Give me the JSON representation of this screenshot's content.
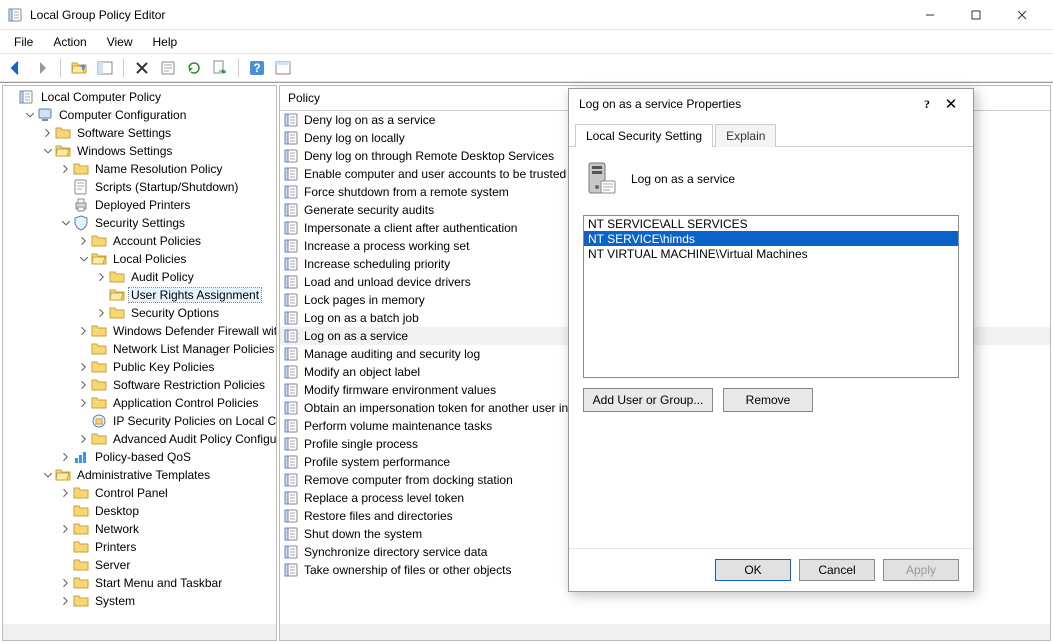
{
  "window": {
    "title": "Local Group Policy Editor"
  },
  "menu": {
    "file": "File",
    "action": "Action",
    "view": "View",
    "help": "Help"
  },
  "tree": {
    "root": "Local Computer Policy",
    "cc": "Computer Configuration",
    "sw": "Software Settings",
    "ws": "Windows Settings",
    "nrp": "Name Resolution Policy",
    "scripts": "Scripts (Startup/Shutdown)",
    "dp": "Deployed Printers",
    "ss": "Security Settings",
    "ap": "Account Policies",
    "lp": "Local Policies",
    "audit": "Audit Policy",
    "ura": "User Rights Assignment",
    "so": "Security Options",
    "wdf": "Windows Defender Firewall with Advanced Security",
    "nlm": "Network List Manager Policies",
    "pkp": "Public Key Policies",
    "srp": "Software Restriction Policies",
    "acp": "Application Control Policies",
    "ips": "IP Security Policies on Local Computer",
    "aap": "Advanced Audit Policy Configuration",
    "pbq": "Policy-based QoS",
    "at": "Administrative Templates",
    "cp": "Control Panel",
    "dk": "Desktop",
    "net": "Network",
    "prn": "Printers",
    "srv": "Server",
    "smt": "Start Menu and Taskbar",
    "sys": "System"
  },
  "list": {
    "header": "Policy",
    "items": [
      "Deny log on as a service",
      "Deny log on locally",
      "Deny log on through Remote Desktop Services",
      "Enable computer and user accounts to be trusted for delegation",
      "Force shutdown from a remote system",
      "Generate security audits",
      "Impersonate a client after authentication",
      "Increase a process working set",
      "Increase scheduling priority",
      "Load and unload device drivers",
      "Lock pages in memory",
      "Log on as a batch job",
      "Log on as a service",
      "Manage auditing and security log",
      "Modify an object label",
      "Modify firmware environment values",
      "Obtain an impersonation token for another user in the same session",
      "Perform volume maintenance tasks",
      "Profile single process",
      "Profile system performance",
      "Remove computer from docking station",
      "Replace a process level token",
      "Restore files and directories",
      "Shut down the system",
      "Synchronize directory service data",
      "Take ownership of files or other objects"
    ],
    "selected_index": 12
  },
  "dialog": {
    "title": "Log on as a service Properties",
    "tab_local": "Local Security Setting",
    "tab_explain": "Explain",
    "heading": "Log on as a service",
    "members": [
      "NT SERVICE\\ALL SERVICES",
      "NT SERVICE\\himds",
      "NT VIRTUAL MACHINE\\Virtual Machines"
    ],
    "selected_member_index": 1,
    "btn_add": "Add User or Group...",
    "btn_remove": "Remove",
    "btn_ok": "OK",
    "btn_cancel": "Cancel",
    "btn_apply": "Apply"
  }
}
